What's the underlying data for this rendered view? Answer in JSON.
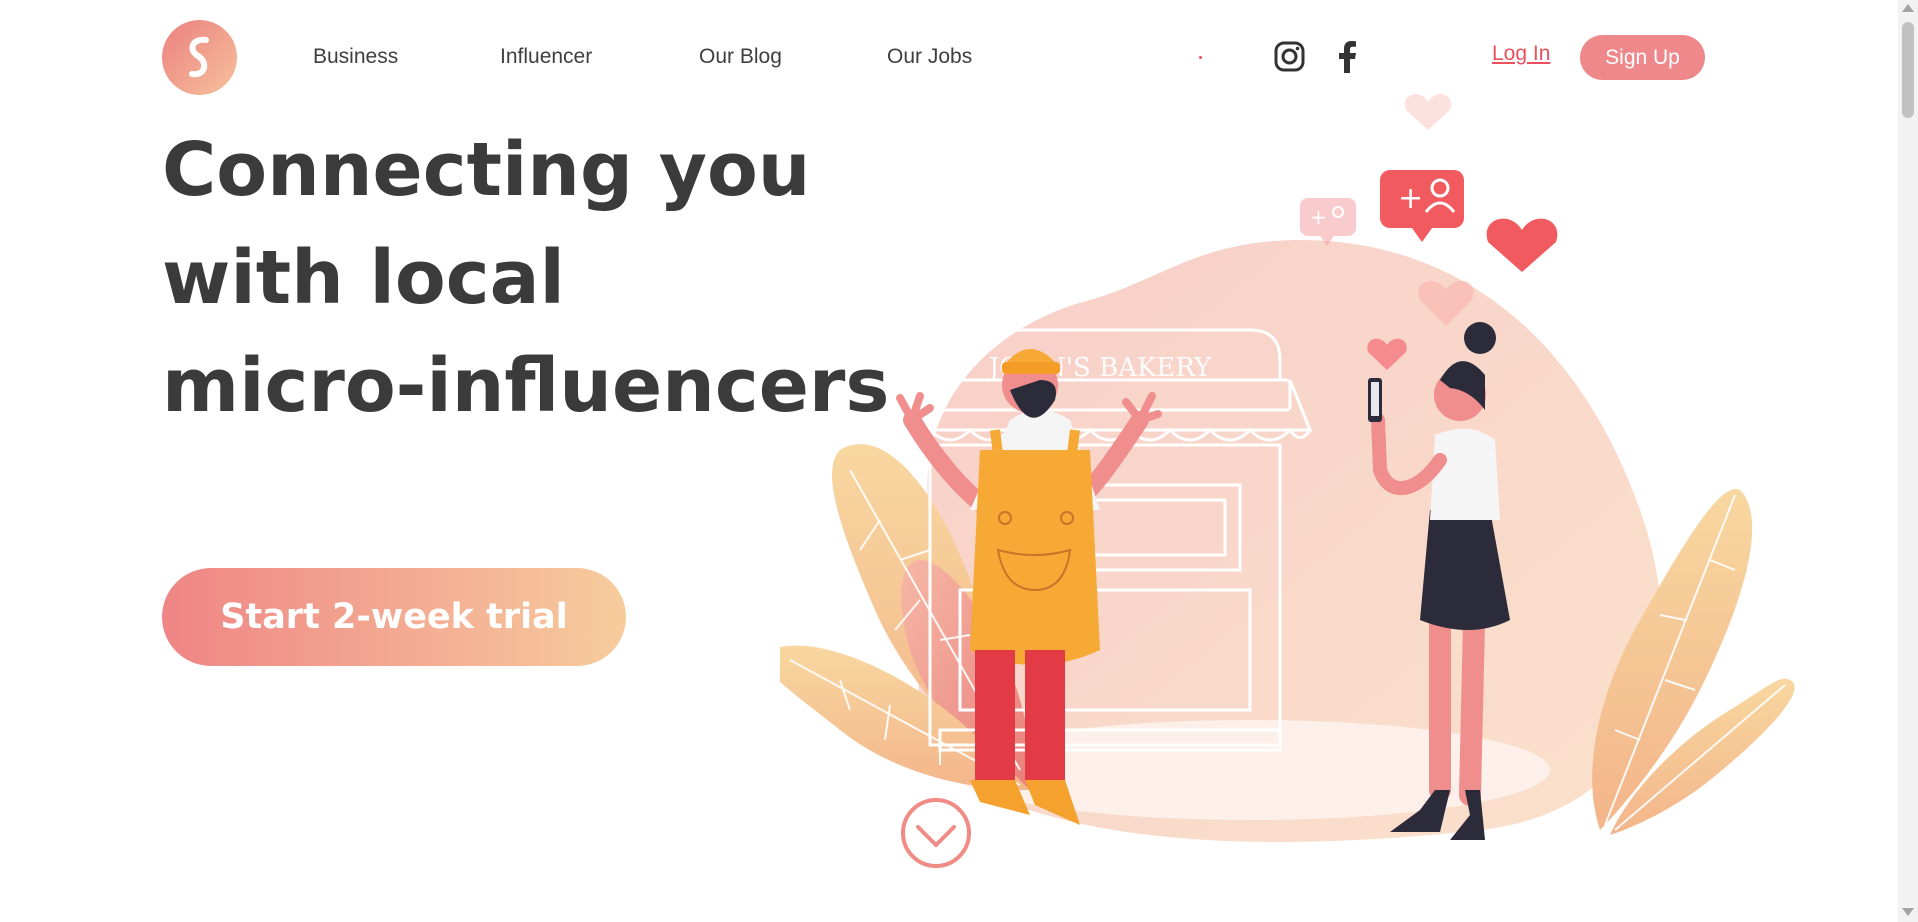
{
  "header": {
    "logo_icon": "s-logo-icon",
    "nav": [
      {
        "label": "Business"
      },
      {
        "label": "Influencer"
      },
      {
        "label": "Our Blog"
      },
      {
        "label": "Our Jobs"
      }
    ],
    "social": [
      "instagram-icon",
      "facebook-icon"
    ],
    "login_label": "Log In",
    "signup_label": "Sign Up"
  },
  "hero": {
    "title_lines": [
      "Connecting you",
      "with local",
      "micro-influencers"
    ],
    "cta_label": "Start 2-week trial"
  },
  "illustration": {
    "bakery_sign": "JOHN'S BAKERY",
    "scroll_icon": "chevron-down-icon"
  },
  "colors": {
    "accent": "#ef888a",
    "link": "#e8505e",
    "text": "#3b3b3b",
    "gradient_start": "#ef8585",
    "gradient_end": "#f7cc9d"
  }
}
